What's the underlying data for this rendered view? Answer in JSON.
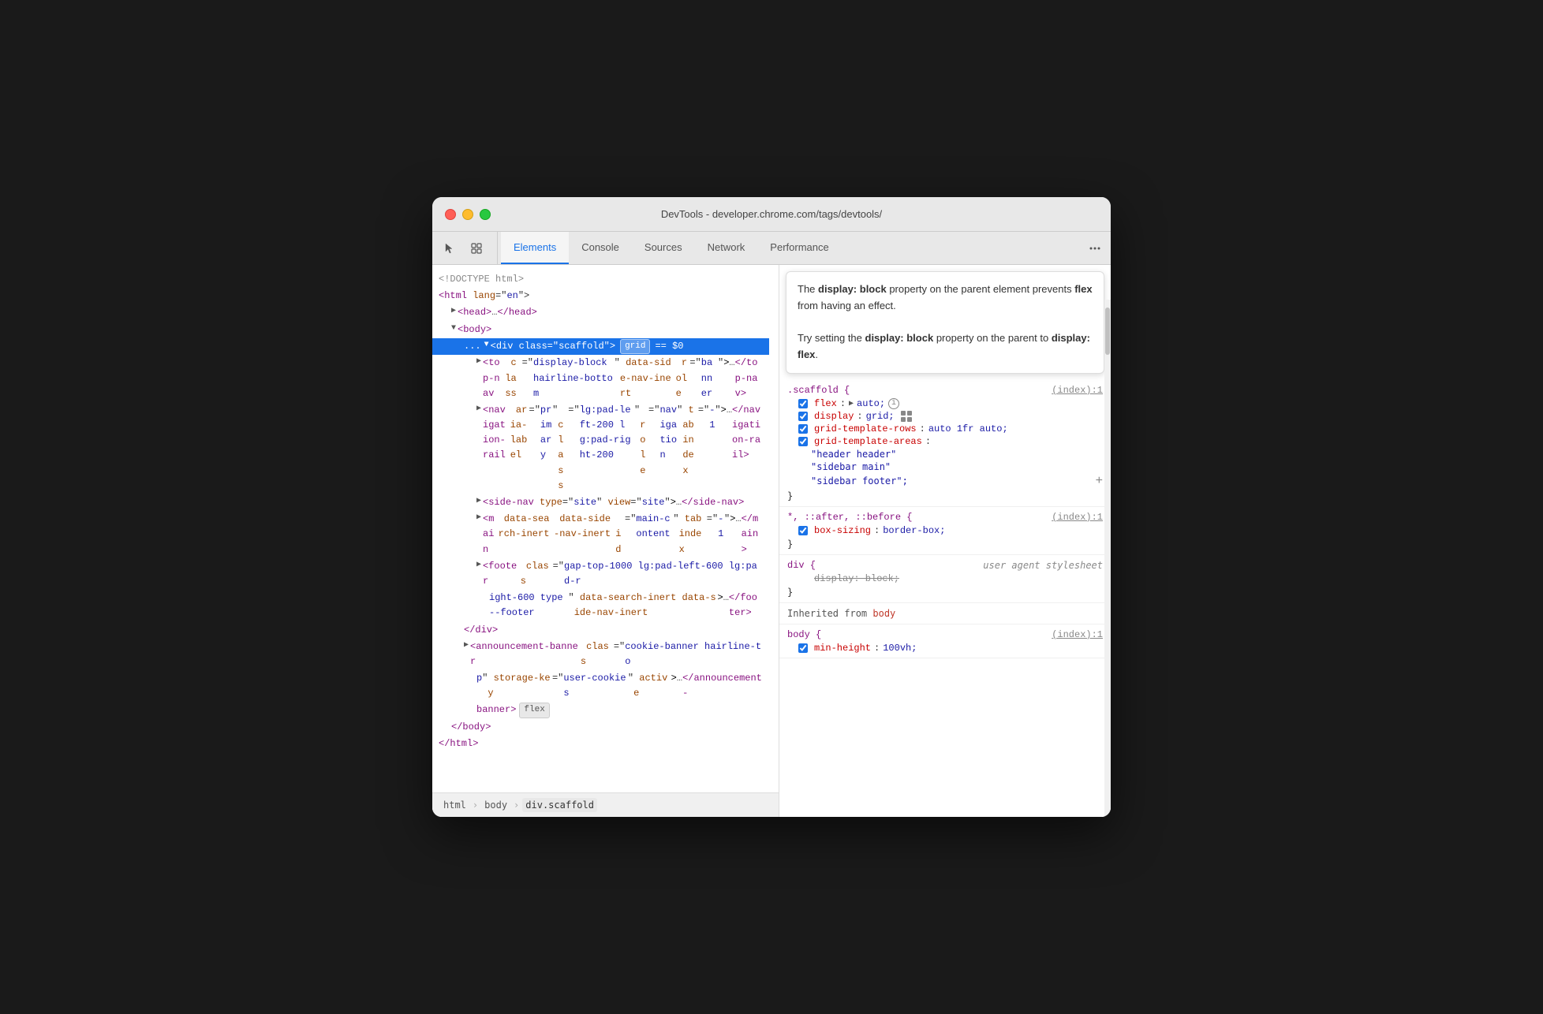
{
  "window": {
    "title": "DevTools - developer.chrome.com/tags/devtools/"
  },
  "tabs": {
    "items": [
      {
        "id": "elements",
        "label": "Elements",
        "active": true
      },
      {
        "id": "console",
        "label": "Console",
        "active": false
      },
      {
        "id": "sources",
        "label": "Sources",
        "active": false
      },
      {
        "id": "network",
        "label": "Network",
        "active": false
      },
      {
        "id": "performance",
        "label": "Performance",
        "active": false
      }
    ]
  },
  "html_tree": {
    "lines": [
      {
        "indent": 0,
        "content": "<!DOCTYPE html>",
        "type": "comment"
      },
      {
        "indent": 0,
        "content": "<html lang=\"en\">",
        "type": "open"
      },
      {
        "indent": 1,
        "content": "▶ <head>…</head>",
        "type": "collapsed"
      },
      {
        "indent": 1,
        "content": "▼ <body>",
        "type": "open"
      },
      {
        "indent": 2,
        "content": "... ▼ <div class=\"scaffold\">  grid  == $0",
        "type": "selected"
      },
      {
        "indent": 3,
        "content": "▶ <top-nav class=\"display-block hairline-bottom\" data-side-nav-inert role=\"banner\">…</top-nav>",
        "type": "normal"
      },
      {
        "indent": 3,
        "content": "▶ <navigation-rail aria-label=\"primary\" class=\"lg:pad-left-200 lg:pad-right-200\" role=\"navigation\" tabindex=\"-1\">…</navigation-rail>",
        "type": "normal"
      },
      {
        "indent": 3,
        "content": "▶ <side-nav type=\"site\" view=\"site\">…</side-nav>",
        "type": "normal"
      },
      {
        "indent": 3,
        "content": "▶ <main data-search-inert data-side-nav-inert id=\"main-content\" tabindex=\"-1\">…</main>",
        "type": "normal"
      },
      {
        "indent": 3,
        "content": "▶ <footer class=\"gap-top-1000 lg:pad-left-600 lg:pad-right-600 type--footer\" data-search-inert data-side-nav-inert>…</footer>",
        "type": "normal"
      },
      {
        "indent": 2,
        "content": "</div>",
        "type": "close"
      },
      {
        "indent": 2,
        "content": "▶ <announcement-banner class=\"cookie-banner hairline-top\" storage-key=\"user-cookies\" active>…</announcement-banner>  flex",
        "type": "normal"
      },
      {
        "indent": 1,
        "content": "</body>",
        "type": "close"
      },
      {
        "indent": 0,
        "content": "</html>",
        "type": "close"
      }
    ]
  },
  "breadcrumbs": [
    "html",
    "body",
    "div.scaffold"
  ],
  "tooltip": {
    "text1": "The ",
    "bold1": "display: block",
    "text2": " property on the parent element prevents ",
    "bold2": "flex",
    "text3": " from having an effect.",
    "text4": "Try setting the ",
    "bold3": "display: block",
    "text5": " property on the parent to ",
    "bold4": "display: flex",
    "text6": "."
  },
  "css_rules": [
    {
      "selector": ".scaffold {",
      "source": "(index):1",
      "properties": [
        {
          "enabled": true,
          "name": "flex",
          "colon": ":",
          "value": "▶ auto;",
          "has_info": true,
          "has_arrow": true
        },
        {
          "enabled": true,
          "name": "display",
          "colon": ":",
          "value": "grid;",
          "has_grid_icon": true
        },
        {
          "enabled": true,
          "name": "grid-template-rows",
          "colon": ":",
          "value": "auto 1fr auto;"
        },
        {
          "enabled": true,
          "name": "grid-template-areas",
          "colon": ":",
          "value": ""
        },
        {
          "indent_value": "\"header header\""
        },
        {
          "indent_value": "\"sidebar main\""
        },
        {
          "indent_value": "\"sidebar footer\";"
        }
      ],
      "close": "}"
    },
    {
      "selector": "*, ::after, ::before {",
      "source": "(index):1",
      "properties": [
        {
          "enabled": true,
          "name": "box-sizing",
          "colon": ":",
          "value": "border-box;"
        }
      ],
      "close": "}"
    },
    {
      "selector": "div {",
      "source": "user agent stylesheet",
      "properties": [
        {
          "enabled": false,
          "name": "display: block;",
          "strikethrough": true
        }
      ],
      "close": "}"
    },
    {
      "type": "inherited",
      "label": "Inherited from",
      "from": "body"
    },
    {
      "selector": "body {",
      "source": "(index):1",
      "properties": [
        {
          "enabled": true,
          "name": "min-height",
          "colon": ":",
          "value": "100vh;"
        }
      ]
    }
  ],
  "colors": {
    "accent_blue": "#1a73e8",
    "tag_purple": "#881280",
    "tag_attr_orange": "#994500",
    "tag_attr_blue": "#1a1aa6",
    "css_prop_red": "#c80000",
    "css_value_blue": "#1a1aa6",
    "red_arrow": "#e53935"
  }
}
